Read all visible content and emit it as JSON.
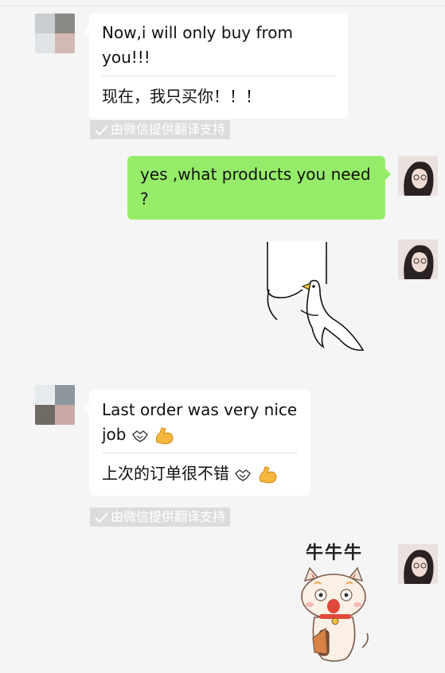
{
  "messages": [
    {
      "side": "left",
      "original": "Now,i will only buy from you!!!",
      "translation": "现在，我只买你！！！",
      "translation_note": "由微信提供翻译支持"
    },
    {
      "side": "right",
      "text": "yes ,what products you need ?"
    },
    {
      "side": "right",
      "sticker": "duck-hanging-on-arm-sticker"
    },
    {
      "side": "left",
      "original": "Last order was very nice job",
      "translation": "上次的订单很不错",
      "translation_note": "由微信提供翻译支持"
    },
    {
      "side": "right",
      "sticker_text": "牛牛牛"
    }
  ],
  "icons": {
    "handshake": "handshake-icon",
    "bicep": "flexed-biceps-icon",
    "check": "check-icon"
  },
  "colors": {
    "background": "#f5f5f5",
    "incoming_bubble": "#ffffff",
    "outgoing_bubble": "#95ec69",
    "translation_badge": "#dcdcdc"
  }
}
